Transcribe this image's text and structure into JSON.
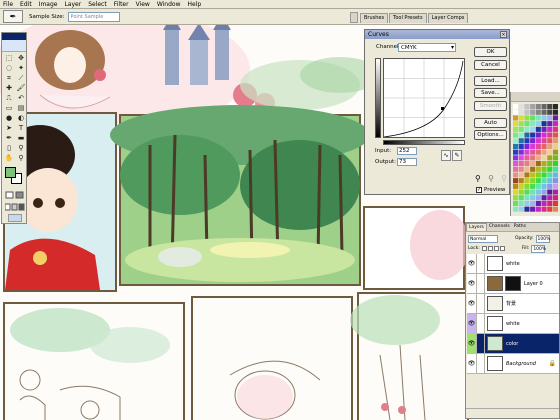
{
  "menu": [
    "File",
    "Edit",
    "Image",
    "Layer",
    "Select",
    "Filter",
    "View",
    "Window",
    "Help"
  ],
  "options_bar": {
    "tool_glyph": "✒",
    "sample_size_label": "Sample Size:",
    "sample_size_value": "Point Sample",
    "palette_tabs": [
      "Brushes",
      "Tool Presets",
      "Layer Comps"
    ]
  },
  "curves": {
    "title": "Curves",
    "channel_label": "Channel:",
    "channel_value": "CMYK",
    "input_label": "Input:",
    "input_value": "252",
    "output_label": "Output:",
    "output_value": "73",
    "buttons": {
      "ok": "OK",
      "cancel": "Cancel",
      "load": "Load...",
      "save": "Save...",
      "smooth": "Smooth",
      "auto": "Auto",
      "options": "Options..."
    },
    "preview_label": "Preview",
    "preview_checked": true
  },
  "layers_panel": {
    "tabs": [
      "Layers",
      "Channels",
      "Paths"
    ],
    "blend_mode": "Normal",
    "opacity_label": "Opacity:",
    "opacity_value": "100%",
    "lock_label": "Lock:",
    "fill_label": "Fill:",
    "fill_value": "100%",
    "layers": [
      {
        "name": "white",
        "selected": false,
        "locked": false,
        "thumb_color": "#ffffff"
      },
      {
        "name": "Layer 0",
        "selected": false,
        "locked": false,
        "thumb_color": "#8a6a3a"
      },
      {
        "name": "背景",
        "selected": false,
        "locked": false,
        "thumb_color": "#f3f0ea"
      },
      {
        "name": "white",
        "selected": false,
        "locked": false,
        "thumb_color": "#ffffff"
      },
      {
        "name": "color",
        "selected": true,
        "locked": false,
        "thumb_color": "#cfe8d0"
      },
      {
        "name": "Background",
        "selected": false,
        "locked": true,
        "thumb_color": "#ffffff"
      }
    ]
  },
  "icons": {
    "close": "×",
    "eye": "👁",
    "lock": "🔒",
    "picker_black": "🖊",
    "curve_mode_smooth": "∿",
    "curve_mode_pencil": "✎"
  }
}
